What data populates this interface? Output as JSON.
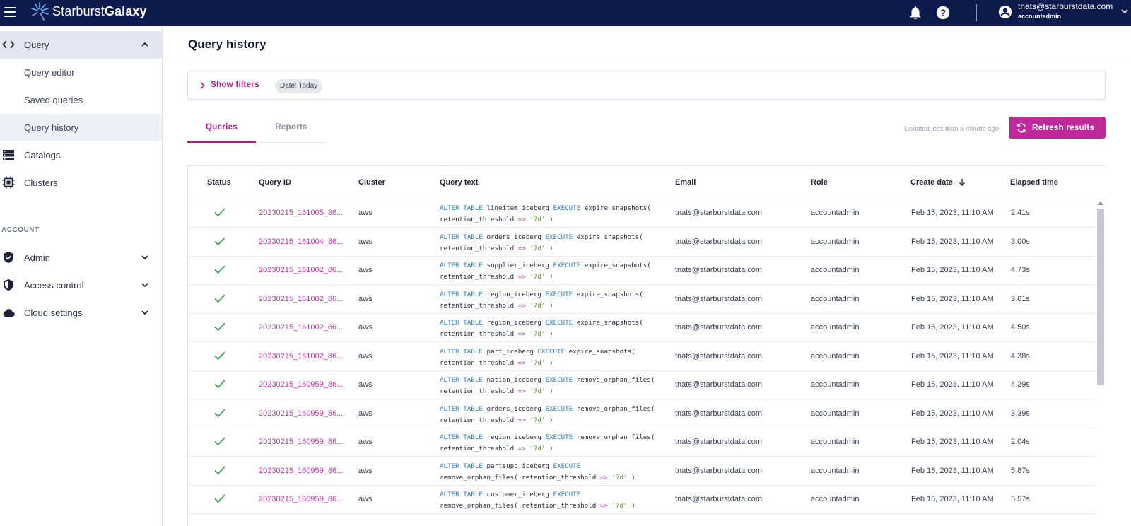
{
  "topbar": {
    "brand_light": "Starburst",
    "brand_bold": "Galaxy",
    "user_email": "tnats@starburstdata.com",
    "user_role": "accountadmin",
    "bg_color": "#0e1b4d"
  },
  "sidebar": {
    "query": "Query",
    "query_editor": "Query editor",
    "saved_queries": "Saved queries",
    "query_history": "Query history",
    "catalogs": "Catalogs",
    "clusters": "Clusters",
    "account_section": "ACCOUNT",
    "admin": "Admin",
    "access_control": "Access control",
    "cloud_settings": "Cloud settings"
  },
  "main": {
    "page_title": "Query history",
    "show_filters": "Show filters",
    "date_chip": "Date: Today",
    "tab_queries": "Queries",
    "tab_reports": "Reports",
    "updated_text": "Updated less than a minute ago",
    "refresh_label": "Refresh results",
    "accent_color": "#b0198a"
  },
  "table": {
    "headers": {
      "status": "Status",
      "query_id": "Query ID",
      "cluster": "Cluster",
      "query_text": "Query text",
      "email": "Email",
      "role": "Role",
      "create_date": "Create date",
      "elapsed": "Elapsed time"
    },
    "rows": [
      {
        "id": "20230215_161005_86...",
        "cluster": "aws",
        "t1": "lineitem_iceberg",
        "t2": "expire_snapshots(",
        "line2": "retention_threshold",
        "split": false,
        "email": "tnats@starburstdata.com",
        "role": "accountadmin",
        "date": "Feb 15, 2023, 11:10 AM",
        "elapsed": "2.41s"
      },
      {
        "id": "20230215_161004_86...",
        "cluster": "aws",
        "t1": "orders_iceberg",
        "t2": "expire_snapshots(",
        "line2": "retention_threshold",
        "split": false,
        "email": "tnats@starburstdata.com",
        "role": "accountadmin",
        "date": "Feb 15, 2023, 11:10 AM",
        "elapsed": "3.00s"
      },
      {
        "id": "20230215_161002_86...",
        "cluster": "aws",
        "t1": "supplier_iceberg",
        "t2": "expire_snapshots(",
        "line2": "retention_threshold",
        "split": false,
        "email": "tnats@starburstdata.com",
        "role": "accountadmin",
        "date": "Feb 15, 2023, 11:10 AM",
        "elapsed": "4.73s"
      },
      {
        "id": "20230215_161002_86...",
        "cluster": "aws",
        "t1": "region_iceberg",
        "t2": "expire_snapshots(",
        "line2": "retention_threshold",
        "split": false,
        "email": "tnats@starburstdata.com",
        "role": "accountadmin",
        "date": "Feb 15, 2023, 11:10 AM",
        "elapsed": "3.61s"
      },
      {
        "id": "20230215_161002_86...",
        "cluster": "aws",
        "t1": "region_iceberg",
        "t2": "expire_snapshots(",
        "line2": "retention_threshold",
        "split": false,
        "email": "tnats@starburstdata.com",
        "role": "accountadmin",
        "date": "Feb 15, 2023, 11:10 AM",
        "elapsed": "4.50s"
      },
      {
        "id": "20230215_161002_86...",
        "cluster": "aws",
        "t1": "part_iceberg",
        "t2": "expire_snapshots(",
        "line2": "retention_threshold",
        "split": false,
        "email": "tnats@starburstdata.com",
        "role": "accountadmin",
        "date": "Feb 15, 2023, 11:10 AM",
        "elapsed": "4.38s"
      },
      {
        "id": "20230215_160959_86...",
        "cluster": "aws",
        "t1": "nation_iceberg",
        "t2": "remove_orphan_files(",
        "line2": "retention_threshold",
        "split": false,
        "email": "tnats@starburstdata.com",
        "role": "accountadmin",
        "date": "Feb 15, 2023, 11:10 AM",
        "elapsed": "4.29s"
      },
      {
        "id": "20230215_160959_86...",
        "cluster": "aws",
        "t1": "orders_iceberg",
        "t2": "remove_orphan_files(",
        "line2": "retention_threshold",
        "split": false,
        "email": "tnats@starburstdata.com",
        "role": "accountadmin",
        "date": "Feb 15, 2023, 11:10 AM",
        "elapsed": "3.39s"
      },
      {
        "id": "20230215_160959_86...",
        "cluster": "aws",
        "t1": "region_iceberg",
        "t2": "remove_orphan_files(",
        "line2": "retention_threshold",
        "split": false,
        "email": "tnats@starburstdata.com",
        "role": "accountadmin",
        "date": "Feb 15, 2023, 11:10 AM",
        "elapsed": "2.04s"
      },
      {
        "id": "20230215_160959_86...",
        "cluster": "aws",
        "t1": "partsupp_iceberg",
        "t2": "",
        "line2": "remove_orphan_files( retention_threshold",
        "split": true,
        "email": "tnats@starburstdata.com",
        "role": "accountadmin",
        "date": "Feb 15, 2023, 11:10 AM",
        "elapsed": "5.87s"
      },
      {
        "id": "20230215_160959_86...",
        "cluster": "aws",
        "t1": "customer_iceberg",
        "t2": "",
        "line2": "remove_orphan_files( retention_threshold",
        "split": true,
        "email": "tnats@starburstdata.com",
        "role": "accountadmin",
        "date": "Feb 15, 2023, 11:10 AM",
        "elapsed": "5.57s"
      }
    ]
  },
  "sql": {
    "alter": "ALTER",
    "table": "TABLE",
    "execute": "EXECUTE",
    "arrow": "=>",
    "value": "'7d'",
    "close": ")"
  }
}
